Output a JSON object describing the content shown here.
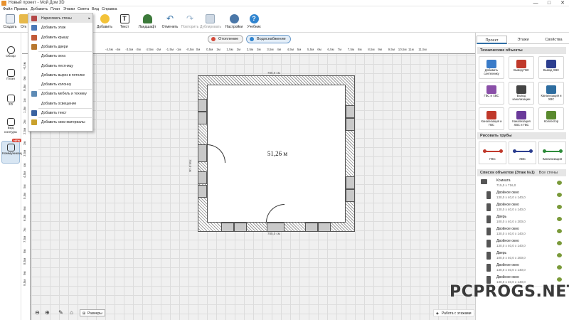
{
  "window": {
    "title": "Новый проект - Мой Дом 3D",
    "controls": [
      "—",
      "□",
      "✕"
    ]
  },
  "menu": [
    "Файл",
    "Правка",
    "Добавить",
    "План",
    "Этажи",
    "Смета",
    "Вид",
    "Справка"
  ],
  "toolbar": {
    "create": "Создать",
    "open": "Отк",
    "add": "Добавить",
    "text": "Текст",
    "landscape": "Ландшафт",
    "undo": "Отменить",
    "redo": "Повторить",
    "duplicate": "Дублировать",
    "settings": "Настройки",
    "tutorial": "Учебник"
  },
  "subbar": {
    "heating": "Отопление",
    "water": "Водоснабжение"
  },
  "sidebar": [
    "Обзор",
    "План",
    "3D",
    "Вид контура",
    "Коммуникации"
  ],
  "sidebar_badge": "NEW",
  "dropdown": [
    {
      "label": "Нарисовать стены",
      "arrow": "▸",
      "color": "#b34747"
    },
    {
      "label": "Добавить этаж",
      "color": "#4b78b6"
    },
    {
      "label": "Добавить крышу",
      "color": "#c25a38"
    },
    {
      "label": "Добавить двери",
      "color": "#b8782f"
    },
    {
      "label": "Добавить окна",
      "color": ""
    },
    {
      "label": "Добавить лестницу",
      "color": ""
    },
    {
      "label": "Добавить вырез в потолке",
      "color": ""
    },
    {
      "label": "Добавить колонну",
      "color": ""
    },
    {
      "label": "Добавить мебель и технику",
      "color": "#5e8bb5"
    },
    {
      "label": "Добавить освещение",
      "color": ""
    },
    {
      "label": "Добавить текст",
      "color": "#3a62a0"
    },
    {
      "label": "Добавить свои материалы",
      "color": "#c9a12c"
    }
  ],
  "ruler_top": [
    "-4,5м",
    "-4м",
    "-3,5м",
    "-3м",
    "-2,5м",
    "-2м",
    "-1,5м",
    "-1м",
    "-0,5м",
    "0м",
    "0,5м",
    "1м",
    "1,5м",
    "2м",
    "2,5м",
    "3м",
    "3,5м",
    "4м",
    "4,5м",
    "5м",
    "5,5м",
    "6м",
    "6,5м",
    "7м",
    "7,5м",
    "8м",
    "8,5м",
    "9м",
    "9,5м",
    "10,5м",
    "11м",
    "11,5м"
  ],
  "ruler_left": [
    "-0,5м",
    "0м",
    "0,5м",
    "1м",
    "1,5м",
    "2м",
    "2,5м",
    "3м",
    "3,5м",
    "4м",
    "4,5м",
    "5м",
    "5,5м",
    "6м",
    "6,5м",
    "7м",
    "7,5м",
    "8м",
    "8,5м",
    "9м",
    "9,5м"
  ],
  "plan": {
    "area": "51,26 м",
    "dim_top": "785,0 см",
    "dim_bottom": "785,0 см",
    "dim_left": "756,0 см"
  },
  "bottom": {
    "sizes": "Размеры",
    "layers": "Работа с этажами"
  },
  "right_panel": {
    "tabs": [
      "Проект",
      "Этажи",
      "Свойства"
    ],
    "tech_title": "Технические объекты",
    "tech_items": [
      "Добавить сантехнику",
      "Вывод ГВС",
      "Вывод ХВС",
      "ГВС и ХВС",
      "Вывод канализации",
      "Канализация и ХВС",
      "Канализация и ГВС",
      "Канализация ХВС и ГВС",
      "Коллектор"
    ],
    "pipes_title": "Рисовать трубы",
    "pipes": [
      {
        "label": "ГВС",
        "color": "#c0392b"
      },
      {
        "label": "ХВС",
        "color": "#2c3e8f"
      },
      {
        "label": "Канализация",
        "color": "#2e8b3a"
      }
    ],
    "list_title": "Список объектов (Этаж №1)",
    "list_action": "Все стены",
    "objects": [
      {
        "name": "Комната",
        "size": "715,0 x 716,0"
      },
      {
        "name": "Двойное окно",
        "size": "130,0 x 40,0 x 140,0"
      },
      {
        "name": "Двойное окно",
        "size": "130,0 x 40,0 x 140,0"
      },
      {
        "name": "Дверь",
        "size": "100,0 x 40,0 x 200,0"
      },
      {
        "name": "Двойное окно",
        "size": "130,0 x 40,0 x 140,0"
      },
      {
        "name": "Двойное окно",
        "size": "130,0 x 40,0 x 140,0"
      },
      {
        "name": "Дверь",
        "size": "100,0 x 40,0 x 200,0"
      },
      {
        "name": "Двойное окно",
        "size": "130,0 x 40,0 x 140,0"
      },
      {
        "name": "Двойное окно",
        "size": "130,0 x 40,0 x 140,0"
      }
    ]
  },
  "watermark": "PCPROGS.NET"
}
